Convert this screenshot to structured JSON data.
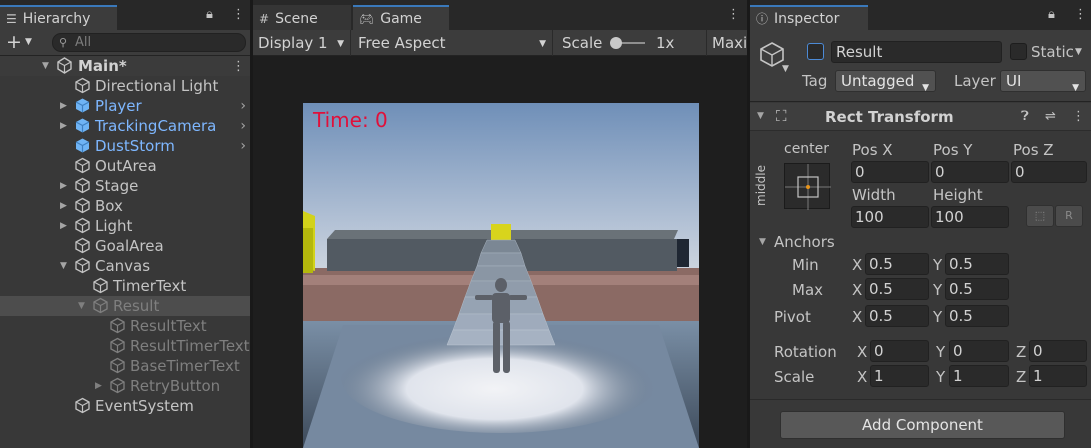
{
  "hierarchy": {
    "tab_label": "Hierarchy",
    "search_placeholder": "All",
    "items": [
      {
        "label": "Main*"
      },
      {
        "label": "Directional Light"
      },
      {
        "label": "Player"
      },
      {
        "label": "TrackingCamera"
      },
      {
        "label": "DustStorm"
      },
      {
        "label": "OutArea"
      },
      {
        "label": "Stage"
      },
      {
        "label": "Box"
      },
      {
        "label": "Light"
      },
      {
        "label": "GoalArea"
      },
      {
        "label": "Canvas"
      },
      {
        "label": "TimerText"
      },
      {
        "label": "Result"
      },
      {
        "label": "ResultText"
      },
      {
        "label": "ResultTimerText"
      },
      {
        "label": "BaseTimerText"
      },
      {
        "label": "RetryButton"
      },
      {
        "label": "EventSystem"
      }
    ]
  },
  "game": {
    "tabs": [
      "Scene",
      "Game"
    ],
    "display": "Display 1",
    "aspect": "Free Aspect",
    "scale_label": "Scale",
    "scale_value": "1x",
    "maximize": "Maxi",
    "time_text": "Time: 0"
  },
  "inspector": {
    "tab_label": "Inspector",
    "object_name": "Result",
    "static_label": "Static",
    "tag_label": "Tag",
    "tag_value": "Untagged",
    "layer_label": "Layer",
    "layer_value": "UI",
    "component_title": "Rect Transform",
    "anchor_h": "center",
    "anchor_v": "middle",
    "pos_x_label": "Pos X",
    "pos_x": "0",
    "pos_y_label": "Pos Y",
    "pos_y": "0",
    "pos_z_label": "Pos Z",
    "pos_z": "0",
    "width_label": "Width",
    "width": "100",
    "height_label": "Height",
    "height": "100",
    "anchors_label": "Anchors",
    "min_label": "Min",
    "min_x": "0.5",
    "min_y": "0.5",
    "max_label": "Max",
    "max_x": "0.5",
    "max_y": "0.5",
    "pivot_label": "Pivot",
    "pivot_x": "0.5",
    "pivot_y": "0.5",
    "rotation_label": "Rotation",
    "rot_x": "0",
    "rot_y": "0",
    "rot_z": "0",
    "scale_label": "Scale",
    "scale_x": "1",
    "scale_y": "1",
    "scale_z": "1",
    "axis_x": "X",
    "axis_y": "Y",
    "axis_z": "Z",
    "raw_btn": "R",
    "add_component": "Add Component"
  },
  "colors": {
    "accent": "#3a79bb",
    "prefab_text": "#7eb7ff",
    "timer_text": "#e0103a"
  }
}
